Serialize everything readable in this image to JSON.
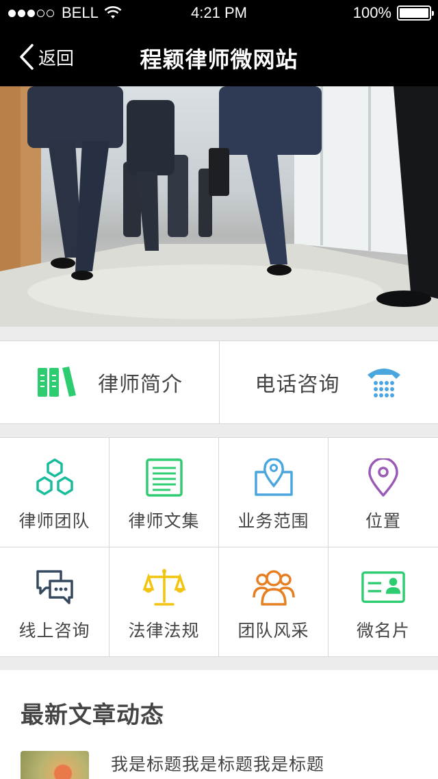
{
  "status_bar": {
    "carrier": "BELL",
    "time": "4:21 PM",
    "battery": "100%",
    "signal_bars_filled": 3,
    "signal_bars_total": 5
  },
  "nav": {
    "back_label": "返回",
    "title": "程颖律师微网站"
  },
  "quick_links": [
    {
      "label": "律师简介",
      "icon": "books-icon",
      "color": "#2ecc71"
    },
    {
      "label": "电话咨询",
      "icon": "telephone-icon",
      "color": "#4aa6df"
    }
  ],
  "menu": [
    {
      "label": "律师团队",
      "icon": "hexagons-icon",
      "color": "#1abc9c"
    },
    {
      "label": "律师文集",
      "icon": "document-icon",
      "color": "#2ecc71"
    },
    {
      "label": "业务范围",
      "icon": "map-pin-icon",
      "color": "#4aa6df"
    },
    {
      "label": "位置",
      "icon": "location-icon",
      "color": "#9b59b6"
    },
    {
      "label": "线上咨询",
      "icon": "chat-icon",
      "color": "#34495e"
    },
    {
      "label": "法律法规",
      "icon": "scales-icon",
      "color": "#f1c40f"
    },
    {
      "label": "团队风采",
      "icon": "people-icon",
      "color": "#e67e22"
    },
    {
      "label": "微名片",
      "icon": "id-card-icon",
      "color": "#2ecc71"
    }
  ],
  "news": {
    "heading": "最新文章动态",
    "items": [
      {
        "title": "我是标题我是标题我是标题"
      }
    ]
  }
}
